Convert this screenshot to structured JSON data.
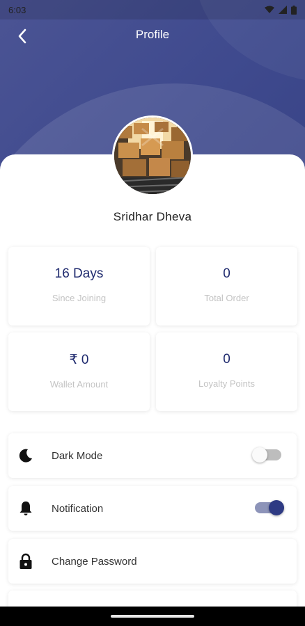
{
  "status_bar": {
    "time": "6:03"
  },
  "app_bar": {
    "title": "Profile"
  },
  "profile": {
    "name": "Sridhar Dheva"
  },
  "stats": [
    {
      "value": "16 Days",
      "label": "Since Joining"
    },
    {
      "value": "0",
      "label": "Total Order"
    },
    {
      "value": "₹ 0",
      "label": "Wallet Amount"
    },
    {
      "value": "0",
      "label": "Loyalty Points"
    }
  ],
  "settings": [
    {
      "label": "Dark Mode",
      "icon": "moon-icon",
      "toggle": false
    },
    {
      "label": "Notification",
      "icon": "bell-icon",
      "toggle": true
    },
    {
      "label": "Change Password",
      "icon": "lock-icon"
    }
  ],
  "colors": {
    "header": "#434d8f",
    "accent": "#2e3a83",
    "stat_value": "#1f2a6e",
    "stat_label": "#c3c3c3"
  }
}
